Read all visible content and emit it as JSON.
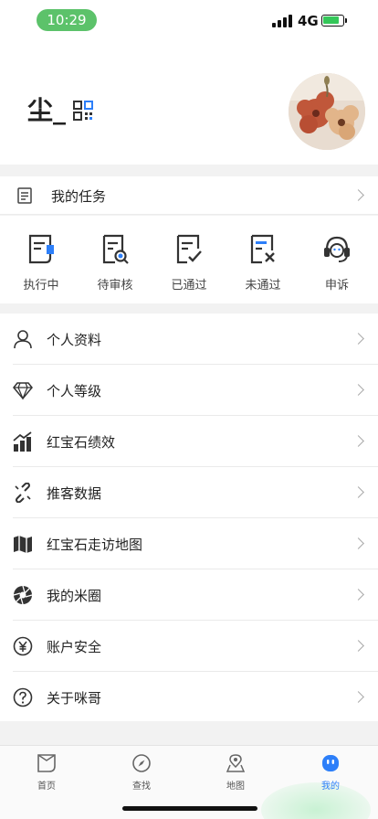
{
  "status_bar": {
    "time": "10:29",
    "network": "4G"
  },
  "profile": {
    "username": "尘_"
  },
  "tasks": {
    "header_label": "我的任务",
    "items": [
      {
        "label": "执行中",
        "icon": "doc-in-progress-icon"
      },
      {
        "label": "待审核",
        "icon": "doc-search-icon"
      },
      {
        "label": "已通过",
        "icon": "doc-check-icon"
      },
      {
        "label": "未通过",
        "icon": "doc-x-icon"
      },
      {
        "label": "申诉",
        "icon": "headset-icon"
      }
    ]
  },
  "menu": {
    "items": [
      {
        "label": "个人资料",
        "icon": "person-icon"
      },
      {
        "label": "个人等级",
        "icon": "diamond-icon"
      },
      {
        "label": "红宝石绩效",
        "icon": "performance-chart-icon"
      },
      {
        "label": "推客数据",
        "icon": "link-icon"
      },
      {
        "label": "红宝石走访地图",
        "icon": "map-icon"
      },
      {
        "label": "我的米圈",
        "icon": "aperture-icon"
      },
      {
        "label": "账户安全",
        "icon": "yuan-icon"
      },
      {
        "label": "关于咪哥",
        "icon": "help-icon"
      }
    ]
  },
  "tabbar": {
    "items": [
      {
        "label": "首页",
        "icon": "home-icon"
      },
      {
        "label": "查找",
        "icon": "compass-icon"
      },
      {
        "label": "地图",
        "icon": "map-pin-icon"
      },
      {
        "label": "我的",
        "icon": "profile-face-icon"
      }
    ],
    "active_index": 3
  },
  "colors": {
    "accent": "#2d7ff9",
    "time_pill": "#5cc26a",
    "battery": "#34c759"
  }
}
